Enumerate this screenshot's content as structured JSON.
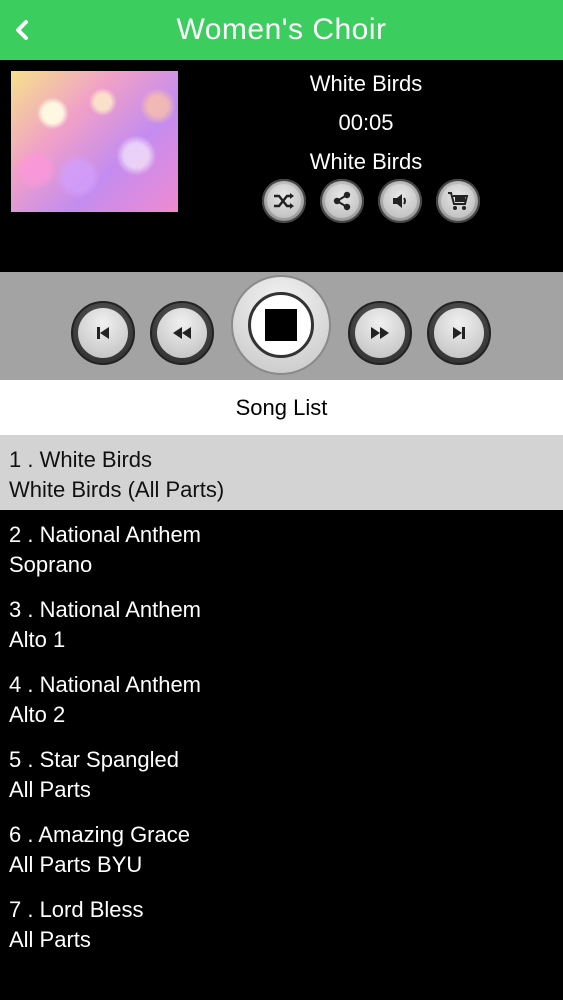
{
  "navbar": {
    "title": "Women's Choir",
    "back_icon": "chevron-left-icon"
  },
  "now_playing": {
    "title": "White Birds",
    "time": "00:05",
    "subtitle": "White Birds"
  },
  "actions": [
    {
      "name": "shuffle",
      "icon": "shuffle-icon"
    },
    {
      "name": "share",
      "icon": "share-icon"
    },
    {
      "name": "volume",
      "icon": "volume-icon"
    },
    {
      "name": "cart",
      "icon": "cart-icon"
    }
  ],
  "transport": {
    "buttons": [
      "skip-previous-icon",
      "rewind-icon",
      "stop-icon",
      "fast-forward-icon",
      "skip-next-icon"
    ]
  },
  "song_list": {
    "header": "Song List",
    "selected_index": 0,
    "items": [
      {
        "title": "1 . White Birds",
        "subtitle": "White Birds (All Parts)"
      },
      {
        "title": "2 . National Anthem",
        "subtitle": "Soprano"
      },
      {
        "title": "3 . National Anthem",
        "subtitle": "Alto 1"
      },
      {
        "title": "4 . National Anthem",
        "subtitle": "Alto 2"
      },
      {
        "title": "5 . Star Spangled",
        "subtitle": "All Parts"
      },
      {
        "title": "6 . Amazing Grace",
        "subtitle": "All Parts BYU"
      },
      {
        "title": "7 . Lord Bless",
        "subtitle": "All Parts"
      }
    ]
  },
  "colors": {
    "accent": "#3ccd5f",
    "selected_row": "#d3d3d3",
    "controls_bar": "#a3a3a3"
  }
}
